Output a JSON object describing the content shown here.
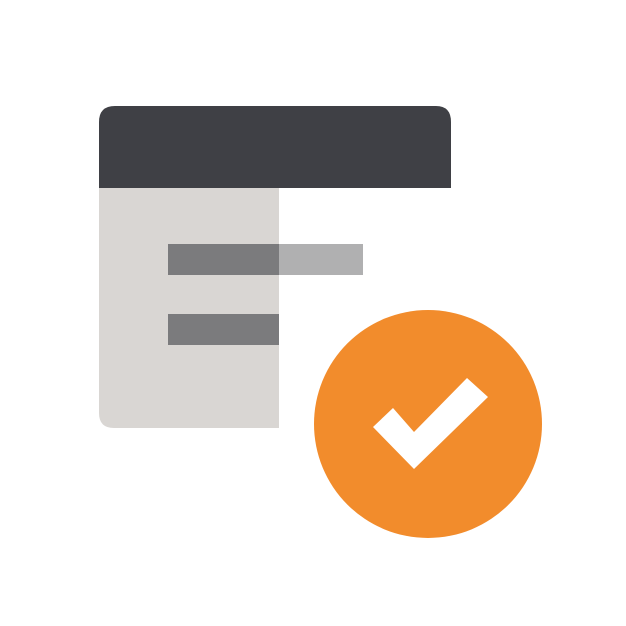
{
  "icon": {
    "name": "form-approved-icon",
    "colors": {
      "window_header": "#3f4045",
      "window_body": "#d9d6d3",
      "line_overlay": "#7b7b7d",
      "line_extension": "#b0b0b1",
      "badge": "#f28c2c",
      "checkmark": "#ffffff",
      "background": "#ffffff"
    }
  }
}
